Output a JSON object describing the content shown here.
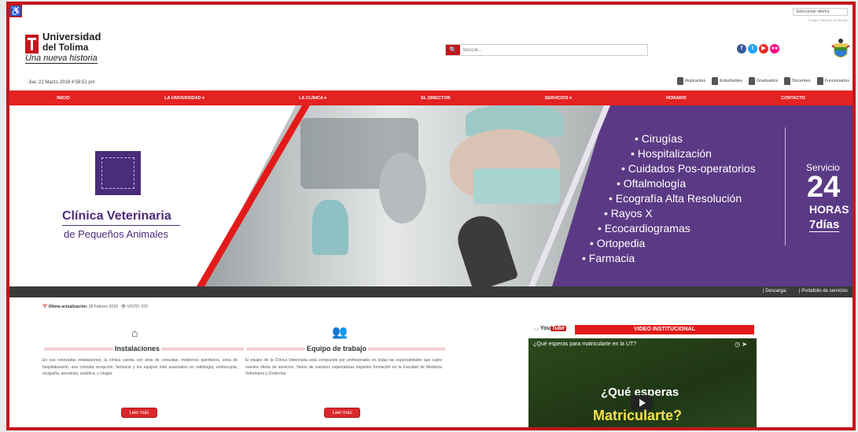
{
  "topbar": {
    "accessibility_icon": "wheelchair-icon",
    "language_select": "Seleccionar idioma",
    "language_note": "Google Traductor de Google"
  },
  "logo": {
    "line1": "Universidad",
    "line2": "del Tolima",
    "tagline": "Una nueva historia"
  },
  "search": {
    "placeholder": "Buscar..."
  },
  "social": [
    "f",
    "t",
    "▶",
    "●●"
  ],
  "date": "Jue, 22 Marzo 2018 4:58:51 pm",
  "roles": [
    "Aspirantes",
    "Estudiantes",
    "Graduados",
    "Docentes",
    "Funcionarios"
  ],
  "nav": [
    "INICIO",
    "LA UNIVERSIDAD ▾",
    "LA CLÍNICA ▾",
    "EL DIRECTOR",
    "SERVICIOS ▾",
    "HORARIO",
    "CONTACTO"
  ],
  "banner": {
    "clinic_name": "Clínica Veterinaria",
    "clinic_sub": "de Pequeños Animales",
    "services": [
      "• Cirugías",
      "• Hospitalización",
      "• Cuidados Pos-operatorios",
      "• Oftalmología",
      "• Ecografía Alta Resolución",
      "• Rayos X",
      "• Ecocardiogramas",
      "• Ortopedia",
      "• Farmacia"
    ],
    "servicio": "Servicio",
    "hours_num": "24",
    "hours_label": "HORAS",
    "days": "7días"
  },
  "strip": {
    "descarga": "| Descarga:",
    "portafolio": "| Portafolio de servicios"
  },
  "meta": {
    "label": "Última actualización:",
    "date": "28 Febrero 2018",
    "visto": "VISTO: 370"
  },
  "columns": [
    {
      "title": "Instalaciones",
      "text": "En sus renovadas instalaciones, la clínica cuenta con área de consultas, modernos quirófanos, zona de hospitalización, una cómoda recepción, farmacia y los equipos más avanzados en radiología, endoscopia, ecografía, anestesia, analítica, y cirugía.",
      "button": "Leer más"
    },
    {
      "title": "Equipo de trabajo",
      "text": "El equipo de la Clínica Veterinaria está compuesto por profesionales en todas las especialidades que cubre nuestra oferta de servicios. Varios de nuestros especialistas imparten formación en la Facultad de Medicina Veterinaria y Zootecnia.",
      "button": "Leer más"
    }
  ],
  "video": {
    "youtube_label": "You",
    "youtube_tube": "Tube",
    "section_title": "VIDEO INSTITUCIONAL",
    "title": "¿Qué esperas para matricularte en la UT?",
    "overlay1": "¿Qué esperas",
    "overlay2": "Matricularte?"
  },
  "colors": {
    "brand_red": "#c4161c",
    "nav_red": "#e32222",
    "clinic_purple": "#5b3a85"
  }
}
